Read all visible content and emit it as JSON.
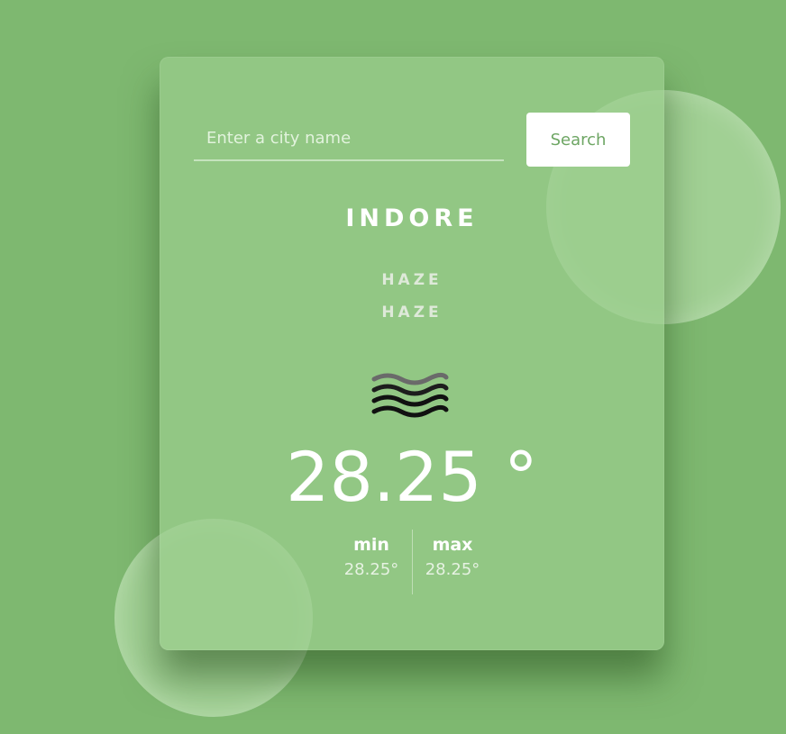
{
  "search": {
    "placeholder": "Enter a city name",
    "value": "",
    "button_label": "Search"
  },
  "weather": {
    "city": "INDORE",
    "condition_main": "HAZE",
    "condition_description": "HAZE",
    "icon": "haze-icon",
    "temperature": "28.25 °",
    "min_label": "min",
    "min_value": "28.25°",
    "max_label": "max",
    "max_value": "28.25°"
  },
  "colors": {
    "background": "#7eb870",
    "card": "#9acd8c",
    "button_text": "#6ea664",
    "text": "#ffffff"
  }
}
